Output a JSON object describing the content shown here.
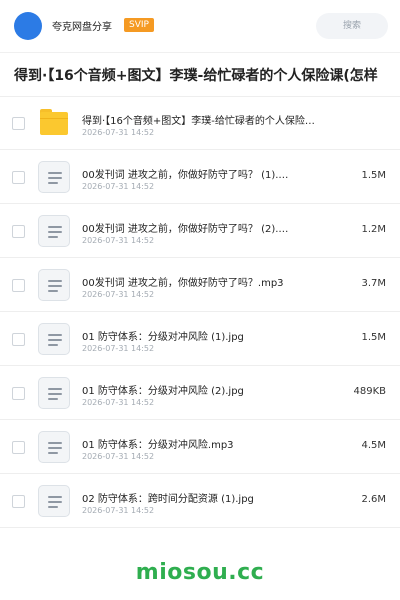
{
  "header": {
    "username": "夸克网盘分享",
    "badge": "SVIP",
    "search_label": "搜索",
    "avatar_color": "#2c7be5",
    "badge_color": "#f59a23"
  },
  "title": "得到·【16个音频+图文】李璞-给忙碌者的个人保险课(怎样",
  "files": [
    {
      "name": "得到·【16个音频+图文】李璞-给忙碌者的个人保险…",
      "date": "2026-07-31 14:52",
      "size": "",
      "type": "folder"
    },
    {
      "name": "00发刊词 进攻之前，你做好防守了吗？ (1).…",
      "date": "2026-07-31 14:52",
      "size": "1.5M",
      "type": "file"
    },
    {
      "name": "00发刊词 进攻之前，你做好防守了吗？ (2).…",
      "date": "2026-07-31 14:52",
      "size": "1.2M",
      "type": "file"
    },
    {
      "name": "00发刊词 进攻之前，你做好防守了吗？.mp3",
      "date": "2026-07-31 14:52",
      "size": "3.7M",
      "type": "file"
    },
    {
      "name": "01 防守体系：分级对冲风险 (1).jpg",
      "date": "2026-07-31 14:52",
      "size": "1.5M",
      "type": "file"
    },
    {
      "name": "01 防守体系：分级对冲风险 (2).jpg",
      "date": "2026-07-31 14:52",
      "size": "489KB",
      "type": "file"
    },
    {
      "name": "01 防守体系：分级对冲风险.mp3",
      "date": "2026-07-31 14:52",
      "size": "4.5M",
      "type": "file"
    },
    {
      "name": "02 防守体系：跨时间分配资源 (1).jpg",
      "date": "2026-07-31 14:52",
      "size": "2.6M",
      "type": "file"
    }
  ],
  "watermark": "miosou.cc",
  "colors": {
    "folder": "#fbc82f",
    "watermark": "#2fae4f"
  }
}
